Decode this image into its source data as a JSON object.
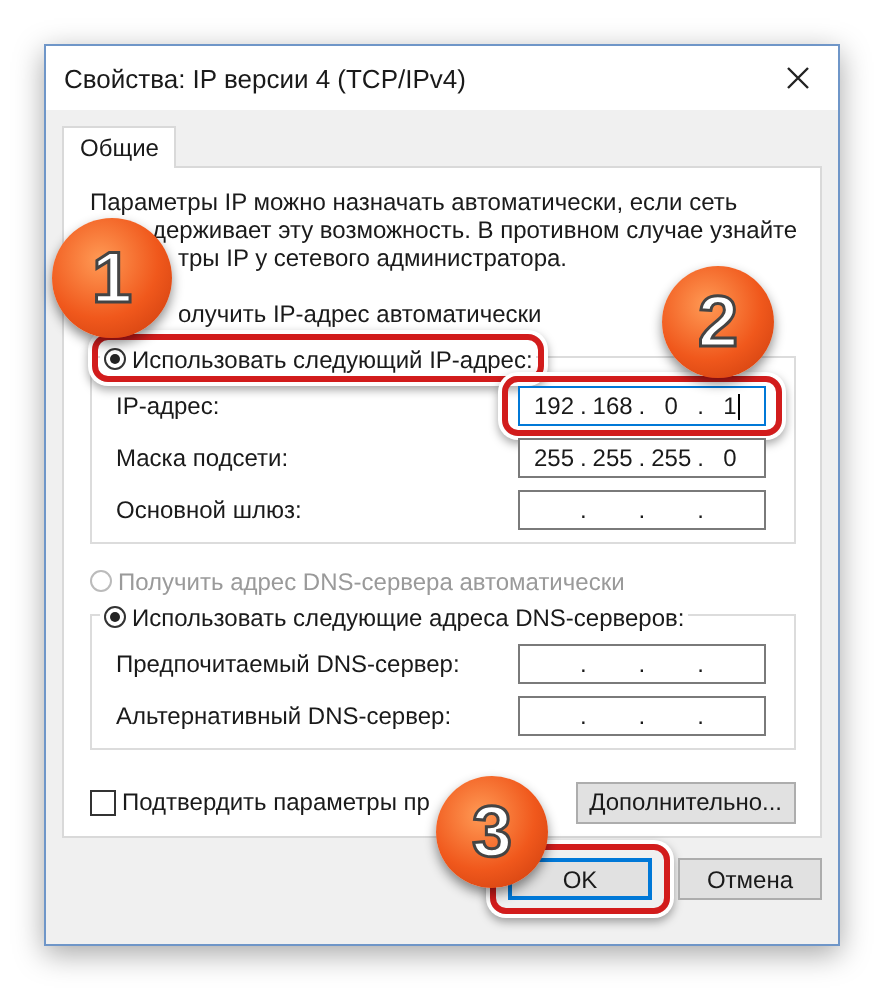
{
  "window": {
    "title": "Свойства: IP версии 4 (TCP/IPv4)"
  },
  "tabs": [
    {
      "label": "Общие",
      "selected": true
    }
  ],
  "intro_lines": [
    "Параметры IP можно назначать автоматически, если сеть",
    "держивает эту возможность. В противном случае узнайте",
    "тры IP у сетевого администратора."
  ],
  "ip_auto_text": "олучить IP-адрес автоматически",
  "ip_manual": {
    "label": "Использовать следующий IP-адрес:",
    "selected": true
  },
  "octet_separator": ".",
  "ip_fields": [
    {
      "label": "IP-адрес:",
      "octets": [
        "192",
        "168",
        "0",
        "1"
      ],
      "focused": true,
      "highlighted": true
    },
    {
      "label": "Маска подсети:",
      "octets": [
        "255",
        "255",
        "255",
        "0"
      ],
      "focused": false,
      "highlighted": false
    },
    {
      "label": "Основной шлюз:",
      "focused": false,
      "highlighted": false
    }
  ],
  "dns_options": [
    {
      "label": "Получить адрес DNS-сервера автоматически",
      "selected": false,
      "disabled": true
    },
    {
      "label": "Использовать следующие адреса DNS-серверов:",
      "selected": true,
      "disabled": false
    }
  ],
  "dns_fields": [
    {
      "label": "Предпочитаемый DNS-сервер:"
    },
    {
      "label": "Альтернативный DNS-сервер:"
    }
  ],
  "confirm": {
    "label": "Подтвердить параметры пр",
    "checked": false
  },
  "advanced_button": "Дополнительно...",
  "buttons": [
    {
      "label": "OK",
      "default": true,
      "highlighted": true
    },
    {
      "label": "Отмена",
      "default": false,
      "highlighted": false
    }
  ],
  "step_badges": [
    "1",
    "2",
    "3"
  ]
}
